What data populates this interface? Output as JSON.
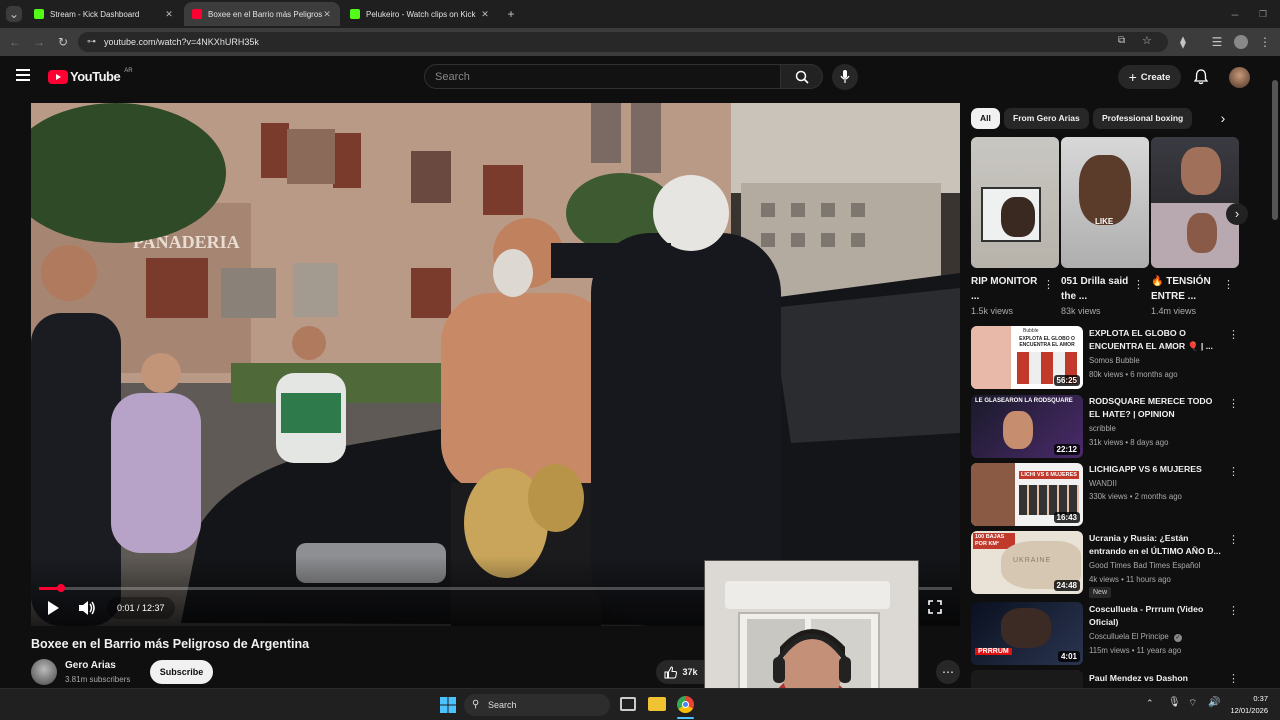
{
  "browser": {
    "tabs": [
      {
        "label": "Stream - Kick Dashboard",
        "favicon": "kick-icon",
        "active": false
      },
      {
        "label": "Boxee en el Barrio más Peligroso",
        "favicon": "youtube-icon",
        "active": true
      },
      {
        "label": "Pelukeiro - Watch clips on Kick",
        "favicon": "kick-icon",
        "active": false
      }
    ],
    "url": "youtube.com/watch?v=4NKXhURH35k"
  },
  "youtube": {
    "logo_text": "YouTube",
    "region": "AR",
    "search_placeholder": "Search",
    "create_label": "Create"
  },
  "player": {
    "time": "0:01 / 12:37",
    "progress_fraction": 0.0013,
    "scene_sign": "PANADERIA"
  },
  "video": {
    "title": "Boxee en el Barrio más Peligroso de Argentina",
    "channel": "Gero Arias",
    "subscribers": "3.81m subscribers",
    "subscribe_label": "Subscribe",
    "likes": "37k"
  },
  "chips": [
    "All",
    "From Gero Arias",
    "Professional boxing"
  ],
  "shorts": [
    {
      "title": "RIP MONITOR ...",
      "views": "1.5k views"
    },
    {
      "title": "051 Drilla said the ...",
      "views": "83k views",
      "thumb_text": "LIKE"
    },
    {
      "title": "🔥 TENSIÓN ENTRE ...",
      "views": "1.4m views"
    }
  ],
  "recommended": [
    {
      "title": "EXPLOTA EL GLOBO O ENCUENTRA EL AMOR 🎈 | ...",
      "channel": "Somos Bubble",
      "meta": "80k views • 6 months ago",
      "duration": "56:25",
      "thumb_text": "EXPLOTA EL GLOBO O ENCUENTRA EL AMOR",
      "thumb_label": "Bubble"
    },
    {
      "title": "RODSQUARE MERECE TODO EL HATE? | OPINION",
      "channel": "scribble",
      "meta": "31k views • 8 days ago",
      "duration": "22:12",
      "thumb_text": "LE GLASEARON LA RODSQUARE"
    },
    {
      "title": "LICHIGAPP VS 6 MUJERES",
      "channel": "WANDII",
      "meta": "330k views • 2 months ago",
      "duration": "16:43",
      "thumb_text": "LICHI VS 6 MUJERES"
    },
    {
      "title": "Ucrania y Rusia: ¿Están entrando en el ÚLTIMO AÑO D...",
      "channel": "Good Times Bad Times Español",
      "meta": "4k views • 11 hours ago",
      "duration": "24:48",
      "badge": "New",
      "thumb_text": "100 BAJAS POR KM²",
      "thumb_label": "UKRAINE"
    },
    {
      "title": "Cosculluela - Prrrum (Video Oficial)",
      "channel": "Cosculluela El Principe",
      "meta": "115m views • 11 years ago",
      "duration": "4:01",
      "verified": true,
      "thumb_text": "PRRRUM"
    },
    {
      "title": "Paul Mendez vs Dashon",
      "channel": "",
      "meta": "",
      "duration": ""
    }
  ],
  "taskbar": {
    "search_label": "Search",
    "time": "0:37",
    "date": "12/01/2026"
  },
  "colors": {
    "accent": "#ff0033",
    "background": "#0f0f0f",
    "kick_green": "#53fc18"
  }
}
